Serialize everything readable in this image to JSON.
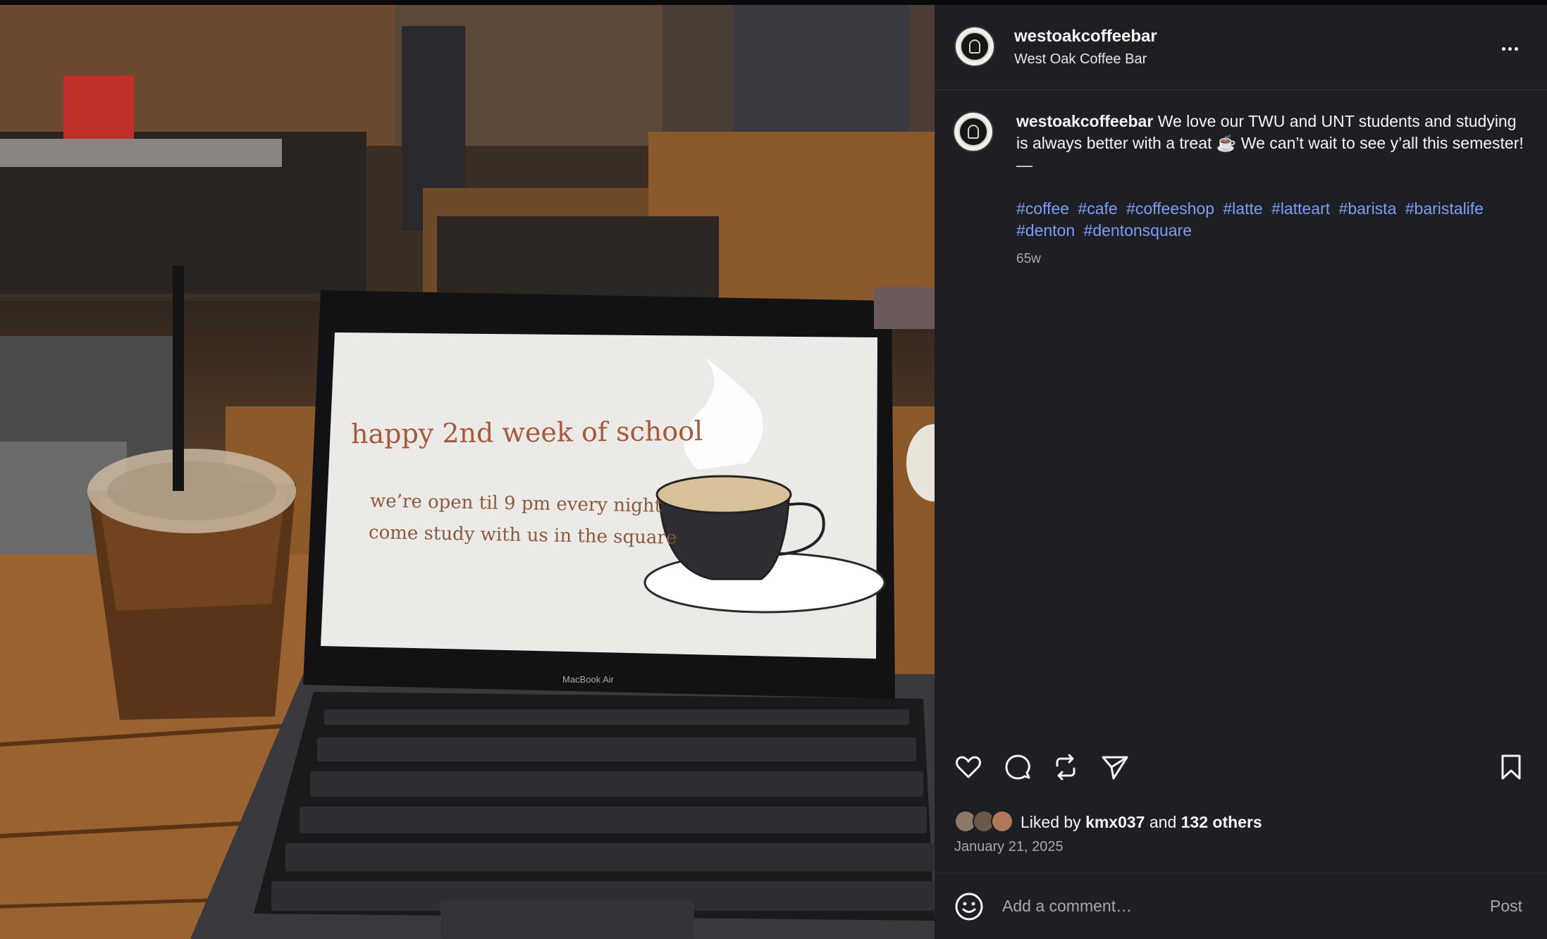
{
  "post": {
    "username": "westoakcoffeebar",
    "display_name": "West Oak Coffee Bar",
    "more_icon": "ellipsis-icon",
    "caption": {
      "username": "westoakcoffeebar",
      "text": "We love our TWU and UNT students and studying is always better with a treat ☕️ We can’t wait to see y’all this semester!",
      "separator": "—",
      "hashtags": [
        "#coffee",
        "#cafe",
        "#coffeeshop",
        "#latte",
        "#latteart",
        "#barista",
        "#baristalife",
        "#denton",
        "#dentonsquare"
      ],
      "time_ago": "65w"
    },
    "image": {
      "screen_title": "happy 2nd week of school",
      "screen_line1": "we’re open til 9 pm every night",
      "screen_line2": "come study with us in the square",
      "laptop_label": "MacBook Air"
    },
    "actions": {
      "like_icon": "heart-icon",
      "comment_icon": "comment-icon",
      "repost_icon": "repost-icon",
      "share_icon": "send-icon",
      "save_icon": "bookmark-icon"
    },
    "likes": {
      "prefix": "Liked by",
      "user": "kmx037",
      "connector": "and",
      "others": "132 others"
    },
    "date": "January 21, 2025",
    "comment": {
      "placeholder": "Add a comment…",
      "post_label": "Post",
      "emoji_icon": "smiley-icon"
    },
    "colors": {
      "panel_bg": "#1d1f24",
      "hashtag": "#7e9bf5",
      "secondary_text": "#a8a8a8"
    }
  }
}
